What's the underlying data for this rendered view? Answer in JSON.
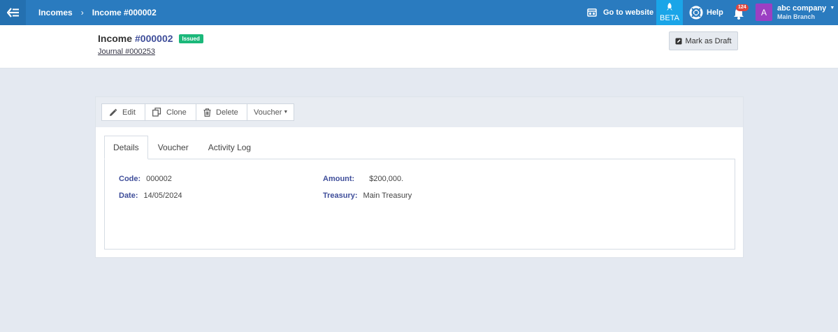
{
  "topbar": {
    "breadcrumb": {
      "parent": "Incomes",
      "separator": "›",
      "current": "Income #000002"
    },
    "go_to_website": "Go to website",
    "beta_label": "BETA",
    "help_label": "Help",
    "notifications_count": "124",
    "account": {
      "initial": "A",
      "company": "abc company",
      "branch": "Main Branch"
    }
  },
  "header": {
    "title_prefix": "Income",
    "title_number": "#000002",
    "status_badge": "Issued",
    "journal_link": "Journal #000253",
    "mark_draft_label": "Mark as Draft"
  },
  "toolbar": {
    "edit": "Edit",
    "clone": "Clone",
    "delete": "Delete",
    "voucher": "Voucher"
  },
  "tabs": [
    "Details",
    "Voucher",
    "Activity Log"
  ],
  "details": {
    "code_label": "Code:",
    "code_value": "000002",
    "date_label": "Date:",
    "date_value": "14/05/2024",
    "amount_label": "Amount:",
    "amount_value": "$200,000.",
    "treasury_label": "Treasury:",
    "treasury_value": "Main Treasury"
  },
  "colors": {
    "topbar": "#2a7bbf",
    "beta": "#1aa5e8",
    "issued_badge": "#1bb87a",
    "label_text": "#3f4e9a",
    "avatar": "#9b3fc3",
    "notification_badge": "#e0463e"
  }
}
